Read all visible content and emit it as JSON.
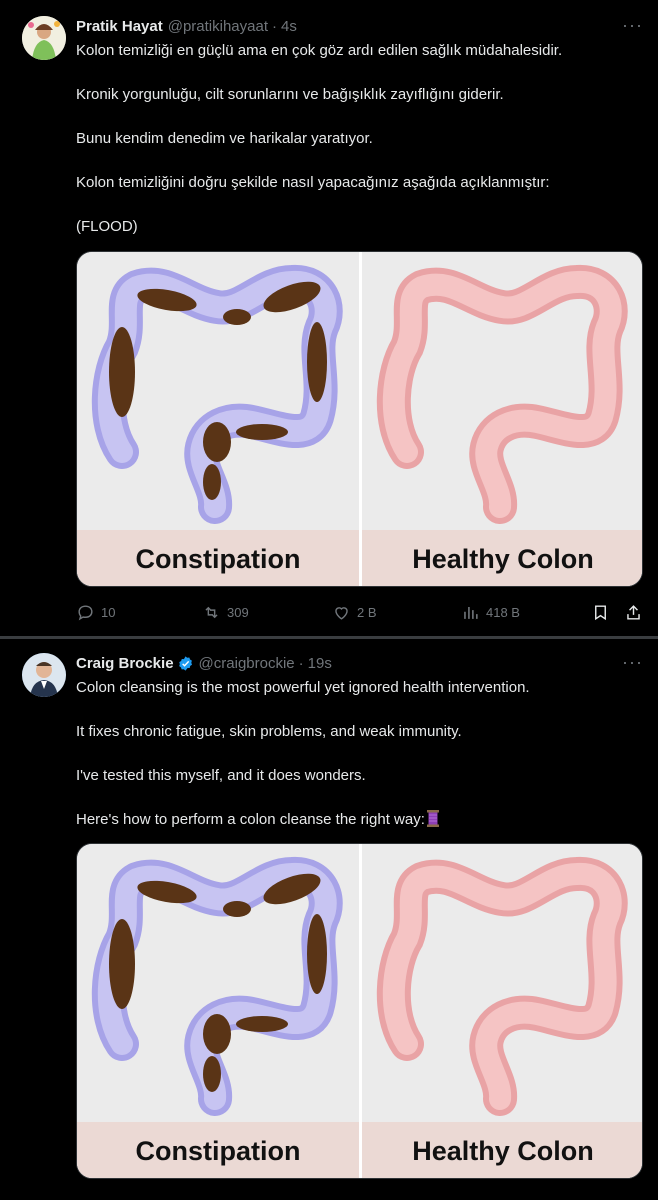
{
  "tweets": [
    {
      "name": "Pratik Hayat",
      "handle": "@pratikihayaat",
      "time": "4s",
      "lines": [
        "Kolon temizliği en güçlü ama en çok göz ardı edilen sağlık müdahalesidir.",
        "Kronik yorgunluğu, cilt sorunlarını ve bağışıklık zayıflığını giderir.",
        "Bunu kendim denedim ve harikalar yaratıyor.",
        "Kolon temizliğini doğru şekilde nasıl yapacağınız aşağıda açıklanmıştır:",
        "(FLOOD)"
      ],
      "media": {
        "left_caption": "Constipation",
        "right_caption": "Healthy Colon"
      },
      "actions": {
        "replies": "10",
        "reposts": "309",
        "likes": "2 B",
        "views": "418 B"
      }
    },
    {
      "name": "Craig Brockie",
      "handle": "@craigbrockie",
      "time": "19s",
      "verified": true,
      "lines": [
        "Colon cleansing is the most powerful yet ignored health intervention.",
        "It fixes chronic fatigue, skin problems, and weak immunity.",
        "I've tested this myself, and it does wonders.",
        "Here's how to perform a colon cleanse the right way:"
      ],
      "media": {
        "left_caption": "Constipation",
        "right_caption": "Healthy Colon"
      }
    }
  ],
  "colors": {
    "accent": "#1d9bf0",
    "muted": "#71767b",
    "bg": "#000000"
  },
  "icons": [
    "more-icon",
    "reply-icon",
    "repost-icon",
    "like-icon",
    "views-icon",
    "bookmark-icon",
    "share-icon",
    "verified-icon",
    "thread-spool-icon"
  ]
}
